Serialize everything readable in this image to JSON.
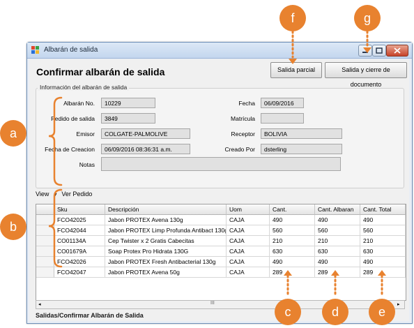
{
  "window": {
    "title": "Albarán de salida",
    "heading": "Confirmar albarán de salida",
    "buttons": {
      "partial": "Salida parcial",
      "close_doc": "Salida y cierre de documento"
    },
    "group_title": "Información del albarán de salida",
    "status": "Salidas/Confirmar Albarán de Salida"
  },
  "form": {
    "albaran_label": "Albarán No.",
    "albaran_value": "10229",
    "pedido_label": "Pedido de salida",
    "pedido_value": "3849",
    "emisor_label": "Emisor",
    "emisor_value": "COLGATE-PALMOLIVE",
    "fecha_creacion_label": "Fecha de Creacion",
    "fecha_creacion_value": "06/09/2016 08:36:31 a.m.",
    "notas_label": "Notas",
    "notas_value": "",
    "fecha_label": "Fecha",
    "fecha_value": "06/09/2016",
    "matricula_label": "Matrícula",
    "matricula_value": "",
    "receptor_label": "Receptor",
    "receptor_value": "BOLIVIA",
    "creado_label": "Creado Por",
    "creado_value": "dsterling"
  },
  "toolbar": {
    "view": "View",
    "ver_pedido": "Ver Pedido"
  },
  "grid": {
    "columns": [
      "Sku",
      "Descripción",
      "Uom",
      "Cant.",
      "Cant. Albaran",
      "Cant. Total"
    ],
    "rows": [
      [
        "FCO42025",
        "Jabon PROTEX Avena 130g",
        "CAJA",
        "490",
        "490",
        "490"
      ],
      [
        "FCO42044",
        "Jabon PROTEX Limp Profunda Antibact 130g",
        "CAJA",
        "560",
        "560",
        "560"
      ],
      [
        "CO01134A",
        "Cep Twister x 2 Gratis Cabecitas",
        "CAJA",
        "210",
        "210",
        "210"
      ],
      [
        "CO01679A",
        "Soap Protex Pro Hidrata 130G",
        "CAJA",
        "630",
        "630",
        "630"
      ],
      [
        "FCO42026",
        "Jabon PROTEX Fresh Antibacterial 130g",
        "CAJA",
        "490",
        "490",
        "490"
      ],
      [
        "FCO42047",
        "Jabon PROTEX Avena 50g",
        "CAJA",
        "289",
        "289",
        "289"
      ]
    ],
    "scroll_glyph": "III"
  },
  "annotations": {
    "a": "a",
    "b": "b",
    "c": "c",
    "d": "d",
    "e": "e",
    "f": "f",
    "g": "g"
  },
  "colors": {
    "annotation": "#e8822f",
    "titlebar": "#c3d6ee"
  }
}
